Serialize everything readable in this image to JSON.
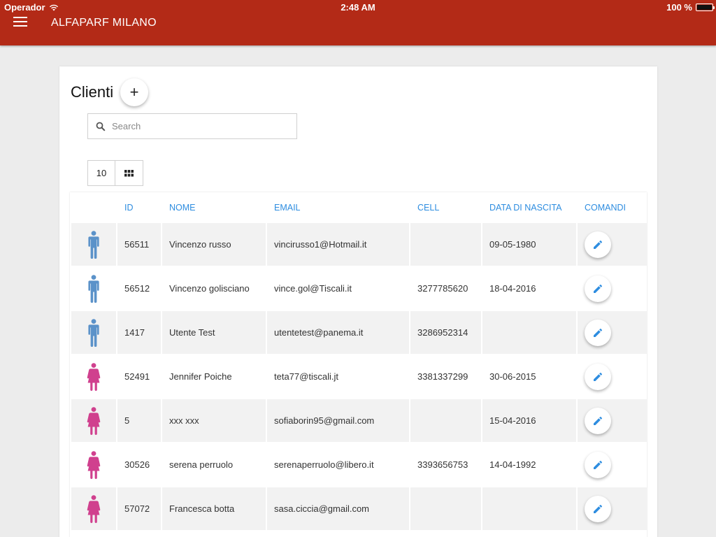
{
  "status_bar": {
    "carrier": "Operador",
    "time": "2:48 AM",
    "battery": "100 %"
  },
  "app": {
    "title": "ALFAPARF MILANO",
    "menu_icon": "hamburger-menu-icon"
  },
  "page": {
    "title": "Clienti",
    "add_label": "+"
  },
  "search": {
    "placeholder": "Search",
    "value": ""
  },
  "pager": {
    "page_size": "10",
    "grid_icon": "grid-view-icon"
  },
  "table": {
    "headers": {
      "gender": "",
      "id": "ID",
      "name": "NOME",
      "email": "EMAIL",
      "cell": "CELL",
      "birth": "DATA DI NASCITA",
      "commands": "COMANDI"
    },
    "rows": [
      {
        "gender": "male",
        "id": "56511",
        "name": "Vincenzo russo",
        "email": "vincirusso1@Hotmail.it",
        "cell": "",
        "birth": "09-05-1980"
      },
      {
        "gender": "male",
        "id": "56512",
        "name": "Vincenzo golisciano",
        "email": "vince.gol@Tiscali.it",
        "cell": "3277785620",
        "birth": "18-04-2016"
      },
      {
        "gender": "male",
        "id": "1417",
        "name": "Utente Test",
        "email": "utentetest@panema.it",
        "cell": "3286952314",
        "birth": ""
      },
      {
        "gender": "female",
        "id": "52491",
        "name": "Jennifer Poiche",
        "email": "teta77@tiscali.jt",
        "cell": "3381337299",
        "birth": "30-06-2015"
      },
      {
        "gender": "female",
        "id": "5",
        "name": "xxx xxx",
        "email": "sofiaborin95@gmail.com",
        "cell": "",
        "birth": "15-04-2016"
      },
      {
        "gender": "female",
        "id": "30526",
        "name": "serena perruolo",
        "email": "serenaperruolo@libero.it",
        "cell": "3393656753",
        "birth": "14-04-1992"
      },
      {
        "gender": "female",
        "id": "57072",
        "name": "Francesca botta",
        "email": "sasa.ciccia@gmail.com",
        "cell": "",
        "birth": ""
      }
    ]
  },
  "colors": {
    "appbar": "#b32a17",
    "header_text": "#2e8de0",
    "male_icon": "#5b92c9",
    "female_icon": "#d0408e",
    "edit_icon": "#2e8de0"
  }
}
